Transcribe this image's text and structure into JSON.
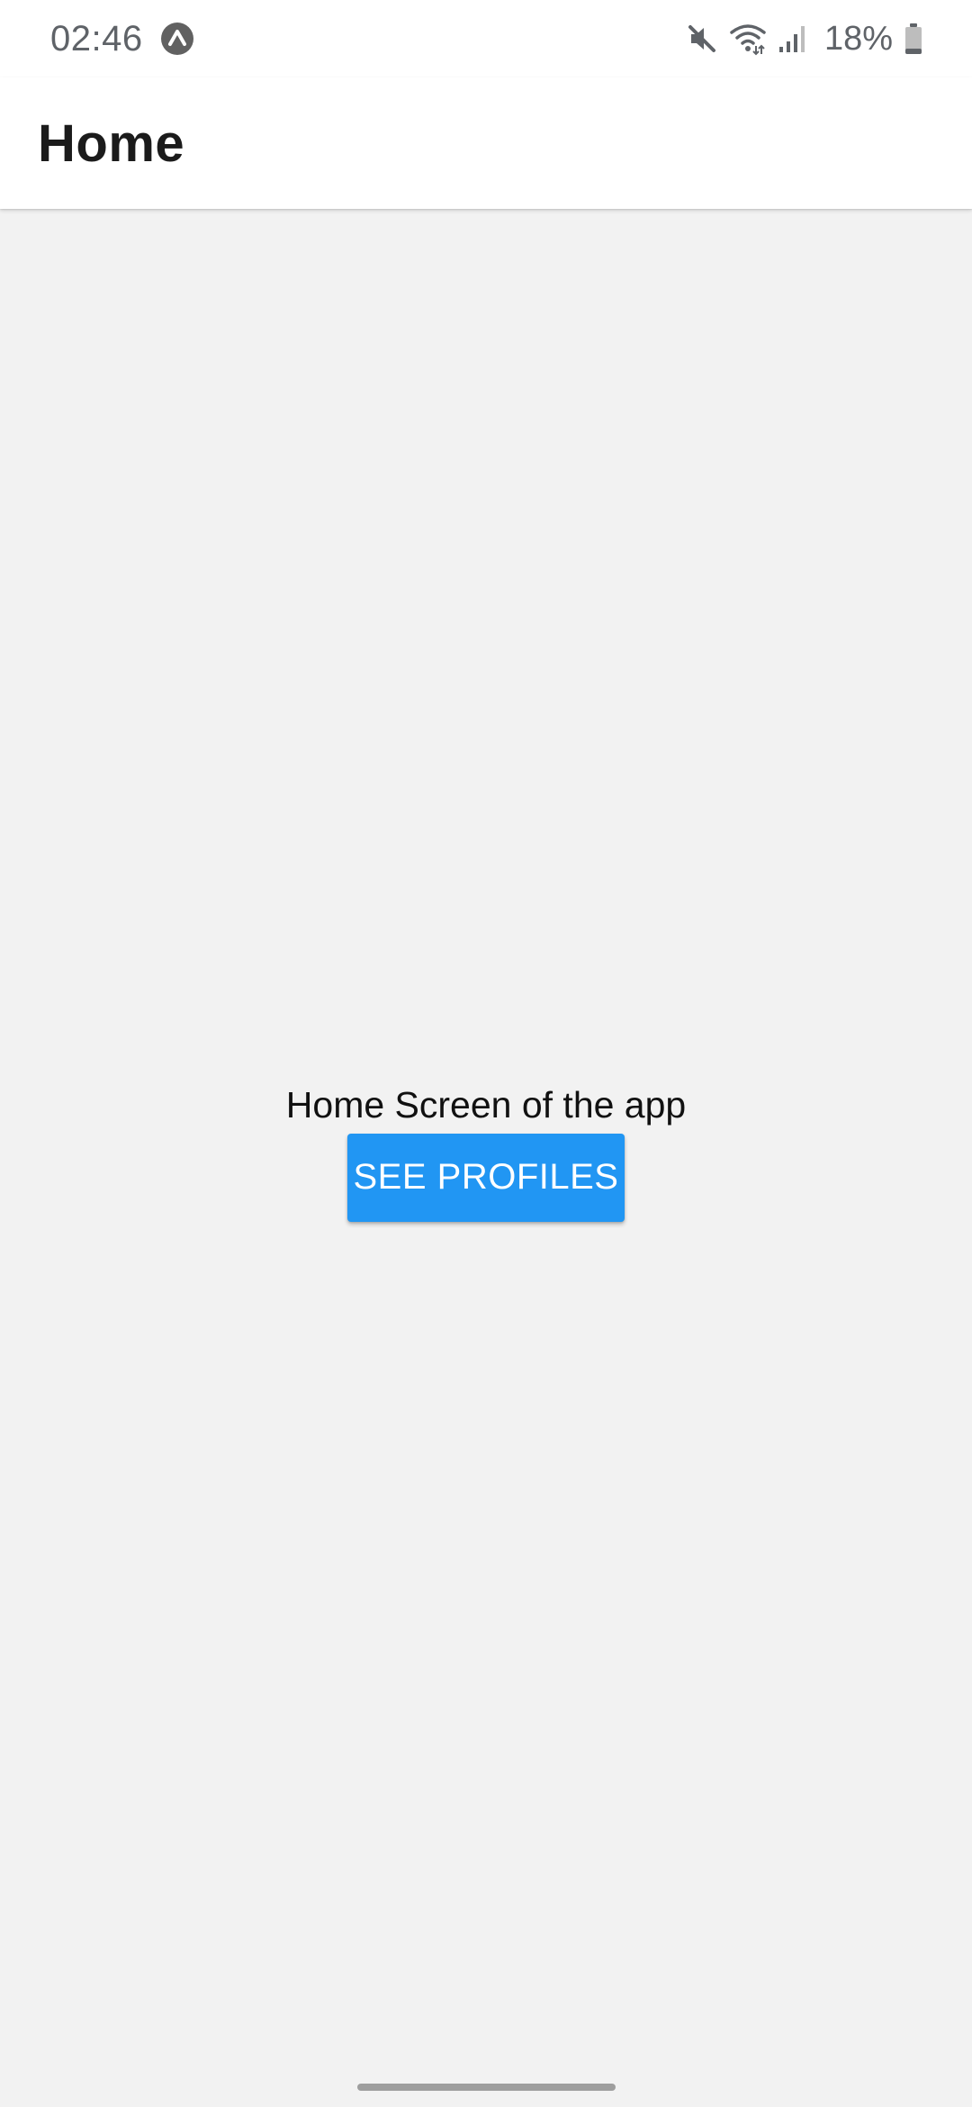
{
  "status_bar": {
    "time": "02:46",
    "battery_percent": "18%",
    "icons": [
      "app-notification-icon",
      "mute-icon",
      "wifi-icon",
      "signal-icon",
      "battery-icon"
    ],
    "battery_level": 0.18
  },
  "app_bar": {
    "title": "Home"
  },
  "main": {
    "text": "Home Screen of the app",
    "button_label": "SEE PROFILES"
  },
  "colors": {
    "accent": "#2196f3",
    "background": "#f2f2f2",
    "app_bar": "#ffffff"
  }
}
